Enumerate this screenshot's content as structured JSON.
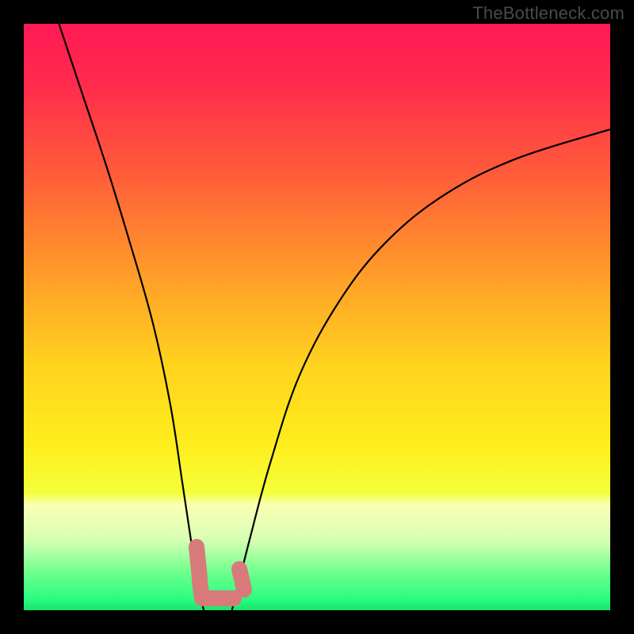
{
  "watermark": {
    "text": "TheBottleneck.com"
  },
  "chart_data": {
    "type": "line",
    "title": "",
    "xlabel": "",
    "ylabel": "",
    "xlim": [
      0,
      100
    ],
    "ylim": [
      0,
      100
    ],
    "gradient_stops": [
      {
        "pct": 0,
        "color": "#ff1a55"
      },
      {
        "pct": 10,
        "color": "#ff2a4d"
      },
      {
        "pct": 25,
        "color": "#ff5a3a"
      },
      {
        "pct": 42,
        "color": "#ff9a2a"
      },
      {
        "pct": 58,
        "color": "#ffd21e"
      },
      {
        "pct": 72,
        "color": "#ffee1e"
      },
      {
        "pct": 80,
        "color": "#f4ff3a"
      },
      {
        "pct": 82,
        "color": "#fbffb4"
      },
      {
        "pct": 88,
        "color": "#d6ffb4"
      },
      {
        "pct": 94,
        "color": "#66ff8a"
      },
      {
        "pct": 98,
        "color": "#2dfc80"
      },
      {
        "pct": 100,
        "color": "#1ae36e"
      }
    ],
    "series": [
      {
        "name": "left-curve",
        "x": [
          6,
          10,
          14,
          18,
          22,
          25,
          27,
          28.5,
          29.5,
          30.2,
          30.7
        ],
        "y": [
          100,
          88,
          76,
          63,
          49,
          35,
          22,
          12,
          6,
          2,
          0
        ]
      },
      {
        "name": "right-curve",
        "x": [
          35.5,
          36.5,
          38.5,
          42,
          47,
          54,
          62,
          72,
          84,
          100
        ],
        "y": [
          0,
          4,
          12,
          25,
          40,
          53,
          63,
          71,
          77,
          82
        ]
      }
    ],
    "annotations": [
      {
        "name": "min-marker-left",
        "shape": "tick",
        "x": 29.5,
        "y": 3
      },
      {
        "name": "min-marker-floor",
        "shape": "L",
        "x": 32,
        "y": 0
      },
      {
        "name": "min-marker-right",
        "shape": "tick",
        "x": 36,
        "y": 3
      }
    ]
  }
}
